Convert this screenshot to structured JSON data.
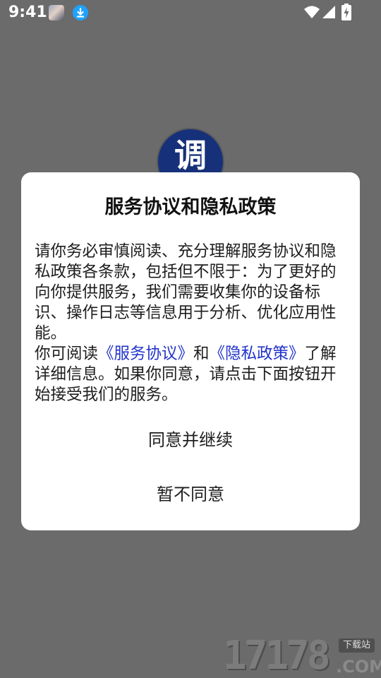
{
  "status_bar": {
    "time": "9:41",
    "icons": [
      "avatar-icon",
      "download-icon",
      "wifi-icon",
      "signal-icon",
      "battery-charging-icon"
    ],
    "download_color": "#1ea2ff"
  },
  "app_logo": {
    "char": "调",
    "color": "#16307a"
  },
  "dialog": {
    "title": "服务协议和隐私政策",
    "body_paragraph_1": "请你务必审慎阅读、充分理解服务协议和隐私政策各条款，包括但不限于：为了更好的向你提供服务，我们需要收集你的设备标识、操作日志等信息用于分析、优化应用性能。",
    "body_paragraph_2_prefix": "你可阅读",
    "service_agreement_link": "《服务协议》",
    "body_paragraph_2_and": "和",
    "privacy_policy_link": "《隐私政策》",
    "body_paragraph_2_suffix": "了解详细信息。如果你同意，请点击下面按钮开始接受我们的服务。",
    "agree_button": "同意并继续",
    "disagree_button": "暂不同意",
    "link_color": "#2233cc"
  },
  "watermark": {
    "digits": "17178",
    "tag": "下载站",
    "suffix": ".COM"
  }
}
